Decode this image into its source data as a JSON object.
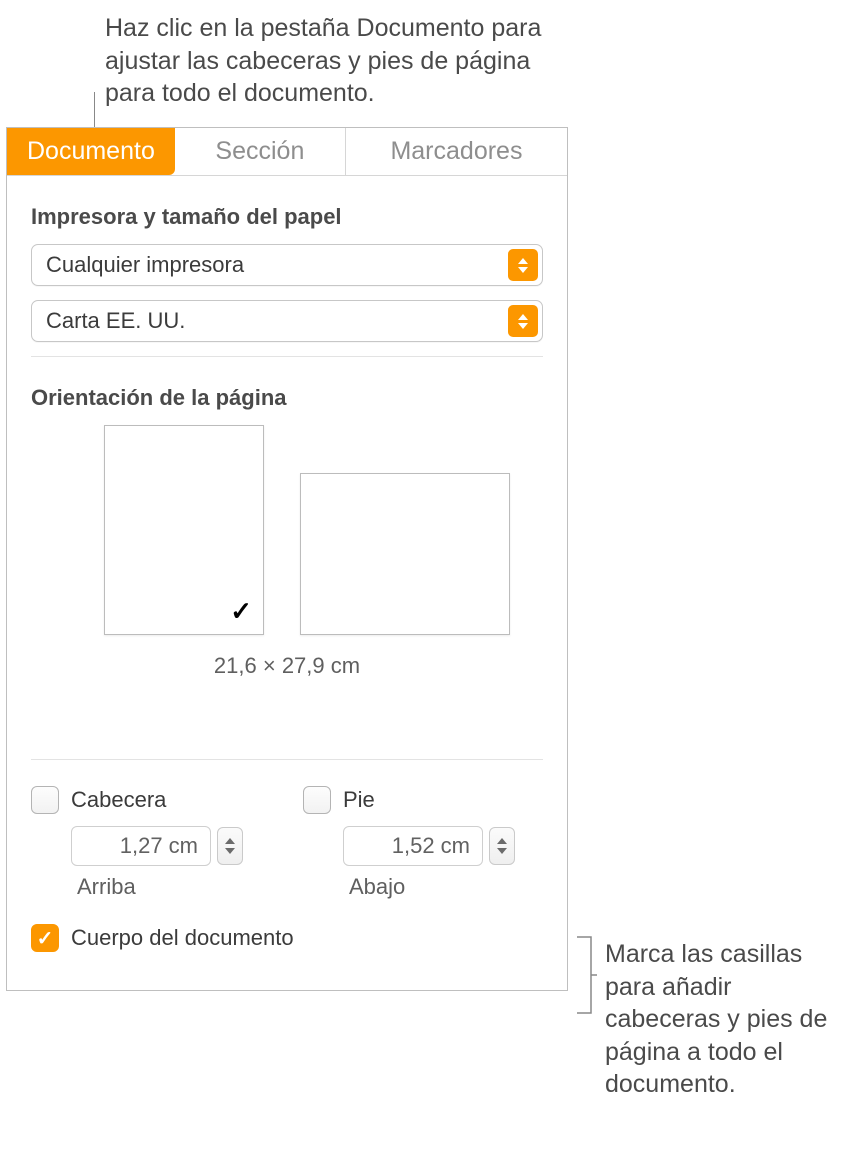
{
  "callouts": {
    "top": "Haz clic en la pestaña Documento para ajustar las cabeceras y pies de página para todo el documento.",
    "right": "Marca las casillas para añadir cabeceras y pies de página a todo el documento."
  },
  "tabs": {
    "documento": "Documento",
    "seccion": "Sección",
    "marcadores": "Marcadores"
  },
  "printer": {
    "title": "Impresora y tamaño del papel",
    "printer_value": "Cualquier impresora",
    "paper_value": "Carta EE. UU."
  },
  "orientation": {
    "title": "Orientación de la página",
    "dimensions": "21,6 × 27,9 cm"
  },
  "headerfooter": {
    "header_label": "Cabecera",
    "footer_label": "Pie",
    "header_value": "1,27 cm",
    "footer_value": "1,52 cm",
    "header_sub": "Arriba",
    "footer_sub": "Abajo"
  },
  "body_checkbox_label": "Cuerpo del documento",
  "colors": {
    "accent": "#fc9700"
  }
}
